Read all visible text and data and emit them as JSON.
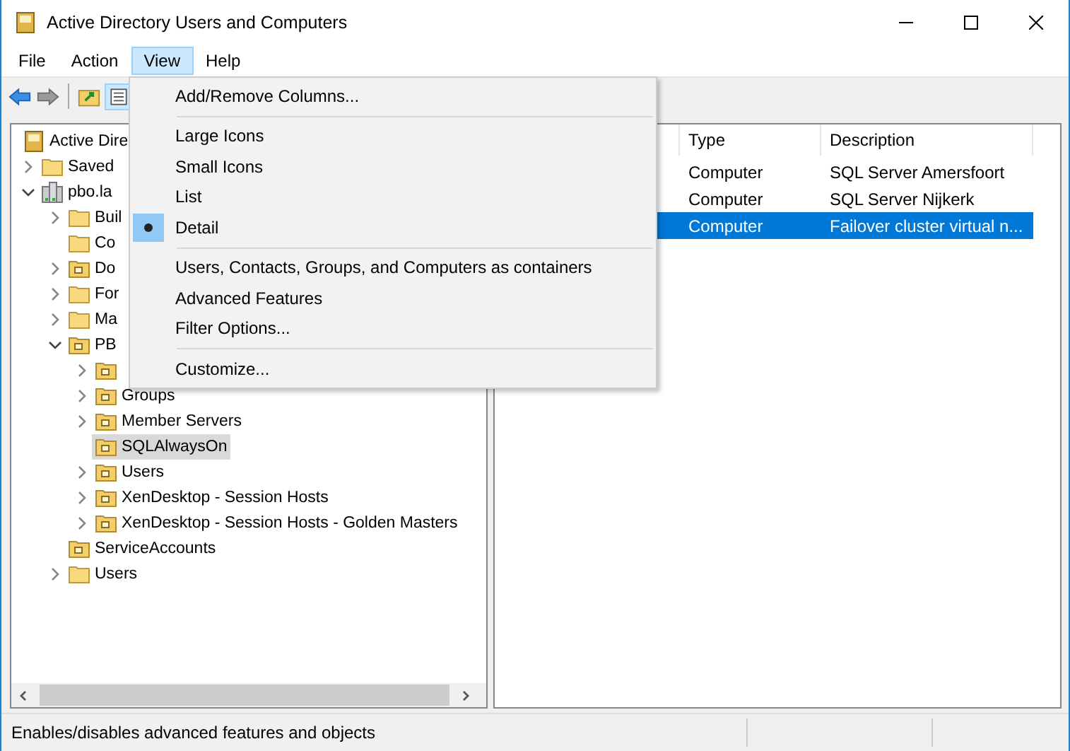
{
  "window": {
    "title": "Active Directory Users and Computers"
  },
  "menu_bar": [
    {
      "label": "File",
      "selected": false
    },
    {
      "label": "Action",
      "selected": false
    },
    {
      "label": "View",
      "selected": true
    },
    {
      "label": "Help",
      "selected": false
    }
  ],
  "view_menu": [
    {
      "kind": "item",
      "label": "Add/Remove Columns...",
      "checked": false
    },
    {
      "kind": "separator"
    },
    {
      "kind": "item",
      "label": "Large Icons",
      "checked": false
    },
    {
      "kind": "item",
      "label": "Small Icons",
      "checked": false
    },
    {
      "kind": "item",
      "label": "List",
      "checked": false
    },
    {
      "kind": "item",
      "label": "Detail",
      "checked": true
    },
    {
      "kind": "separator"
    },
    {
      "kind": "item",
      "label": "Users, Contacts, Groups, and Computers as containers",
      "checked": false
    },
    {
      "kind": "item",
      "label": "Advanced Features",
      "checked": false
    },
    {
      "kind": "item",
      "label": "Filter Options...",
      "checked": false
    },
    {
      "kind": "separator"
    },
    {
      "kind": "item",
      "label": "Customize...",
      "checked": false
    }
  ],
  "tree": [
    {
      "label": "Active Dire",
      "kind": "root",
      "selected": false,
      "children": [
        {
          "label": "Saved",
          "kind": "folder",
          "expanded": false,
          "selected": false
        },
        {
          "label": "pbo.la",
          "kind": "domain",
          "expanded": true,
          "selected": false,
          "children": [
            {
              "label": "Buil",
              "kind": "folder",
              "expanded": false,
              "selected": false
            },
            {
              "label": "Co",
              "kind": "folder",
              "selected": false
            },
            {
              "label": "Do",
              "kind": "ou",
              "expanded": false,
              "selected": false
            },
            {
              "label": "For",
              "kind": "folder",
              "expanded": false,
              "selected": false
            },
            {
              "label": "Ma",
              "kind": "folder",
              "expanded": false,
              "selected": false
            },
            {
              "label": "PB",
              "kind": "ou",
              "expanded": true,
              "selected": false,
              "children": [
                {
                  "kind": "ou",
                  "expanded": false,
                  "selected": false
                },
                {
                  "label": "Groups",
                  "kind": "ou",
                  "expanded": false,
                  "selected": false
                },
                {
                  "label": "Member Servers",
                  "kind": "ou",
                  "expanded": false,
                  "selected": false
                },
                {
                  "label": "SQLAlwaysOn",
                  "kind": "ou",
                  "selected": true
                },
                {
                  "label": "Users",
                  "kind": "ou",
                  "expanded": false,
                  "selected": false
                },
                {
                  "label": "XenDesktop - Session Hosts",
                  "kind": "ou",
                  "expanded": false,
                  "selected": false
                },
                {
                  "label": "XenDesktop - Session Hosts - Golden Masters",
                  "kind": "ou",
                  "expanded": false,
                  "selected": false
                }
              ]
            },
            {
              "label": "ServiceAccounts",
              "kind": "ou",
              "selected": false
            },
            {
              "label": "Users",
              "kind": "folder",
              "expanded": false,
              "selected": false
            }
          ]
        }
      ]
    }
  ],
  "list": {
    "columns": [
      "Type",
      "Description"
    ],
    "rows": [
      {
        "type": "Computer",
        "description": "SQL Server Amersfoort",
        "selected": false
      },
      {
        "type": "Computer",
        "description": "SQL Server Nijkerk",
        "selected": false
      },
      {
        "type": "Computer",
        "description": "Failover cluster virtual n...",
        "selected": true
      }
    ]
  },
  "status_bar": {
    "text": "Enables/disables advanced features and objects"
  }
}
